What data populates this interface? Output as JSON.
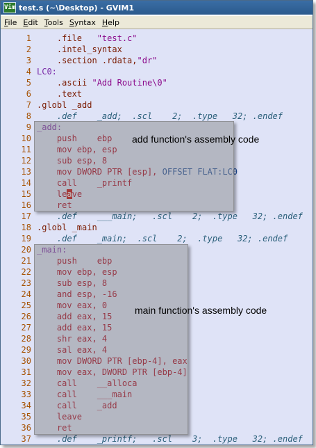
{
  "window": {
    "title": "test.s (~\\Desktop) - GVIM1",
    "icon_label": "Vim"
  },
  "menu": [
    "File",
    "Edit",
    "Tools",
    "Syntax",
    "Help"
  ],
  "callouts": {
    "add": "add function's assembly code",
    "main": "main function's assembly code"
  },
  "lines": [
    {
      "n": "1",
      "parts": [
        [
          "    .file   ",
          "dir"
        ],
        [
          "\"test.c\"",
          "str"
        ]
      ]
    },
    {
      "n": "2",
      "parts": [
        [
          "    .intel_syntax",
          "dir"
        ]
      ]
    },
    {
      "n": "3",
      "parts": [
        [
          "    .section .rdata,",
          "dir"
        ],
        [
          "\"dr\"",
          "str"
        ]
      ]
    },
    {
      "n": "4",
      "parts": [
        [
          "LC0:",
          "lbl"
        ]
      ]
    },
    {
      "n": "5",
      "parts": [
        [
          "    .ascii ",
          "dir"
        ],
        [
          "\"Add Routine\\0\"",
          "str"
        ]
      ]
    },
    {
      "n": "6",
      "parts": [
        [
          "    .text",
          "dir"
        ]
      ]
    },
    {
      "n": "7",
      "parts": [
        [
          ".globl _add",
          "dir"
        ]
      ]
    },
    {
      "n": "8",
      "parts": [
        [
          "    .def    _add;  .scl    2;  .type   32; .endef",
          "type"
        ]
      ]
    },
    {
      "n": "9",
      "parts": [
        [
          "_add:",
          "lbl"
        ]
      ]
    },
    {
      "n": "10",
      "parts": [
        [
          "    push    ebp",
          "kw"
        ]
      ]
    },
    {
      "n": "11",
      "parts": [
        [
          "    mov ebp, esp",
          "kw"
        ]
      ]
    },
    {
      "n": "12",
      "parts": [
        [
          "    sub esp, 8",
          "kw"
        ]
      ]
    },
    {
      "n": "13",
      "parts": [
        [
          "    mov DWORD PTR [esp], ",
          "kw"
        ],
        [
          "OFFSET FLAT:LC0",
          "blue"
        ]
      ]
    },
    {
      "n": "14",
      "parts": [
        [
          "    call    _printf",
          "kw"
        ]
      ]
    },
    {
      "n": "15",
      "parts": [
        [
          "    le",
          "kw"
        ],
        [
          "a",
          "cursor"
        ],
        [
          "ve",
          "kw"
        ]
      ]
    },
    {
      "n": "16",
      "parts": [
        [
          "    ret",
          "kw"
        ]
      ]
    },
    {
      "n": "17",
      "parts": [
        [
          "    .def    ___main;   .scl    2;  .type   32; .endef",
          "type"
        ]
      ]
    },
    {
      "n": "18",
      "parts": [
        [
          ".globl _main",
          "dir"
        ]
      ]
    },
    {
      "n": "19",
      "parts": [
        [
          "    .def    _main;  .scl    2;  .type   32; .endef",
          "type"
        ]
      ]
    },
    {
      "n": "20",
      "parts": [
        [
          "_main:",
          "lbl"
        ]
      ]
    },
    {
      "n": "21",
      "parts": [
        [
          "    push    ebp",
          "kw"
        ]
      ]
    },
    {
      "n": "22",
      "parts": [
        [
          "    mov ebp, esp",
          "kw"
        ]
      ]
    },
    {
      "n": "23",
      "parts": [
        [
          "    sub esp, 8",
          "kw"
        ]
      ]
    },
    {
      "n": "24",
      "parts": [
        [
          "    and esp, -16",
          "kw"
        ]
      ]
    },
    {
      "n": "25",
      "parts": [
        [
          "    mov eax, 0",
          "kw"
        ]
      ]
    },
    {
      "n": "26",
      "parts": [
        [
          "    add eax, 15",
          "kw"
        ]
      ]
    },
    {
      "n": "27",
      "parts": [
        [
          "    add eax, 15",
          "kw"
        ]
      ]
    },
    {
      "n": "28",
      "parts": [
        [
          "    shr eax, 4",
          "kw"
        ]
      ]
    },
    {
      "n": "29",
      "parts": [
        [
          "    sal eax, 4",
          "kw"
        ]
      ]
    },
    {
      "n": "30",
      "parts": [
        [
          "    mov DWORD PTR [ebp-4], eax",
          "kw"
        ]
      ]
    },
    {
      "n": "31",
      "parts": [
        [
          "    mov eax, DWORD PTR [ebp-4]",
          "kw"
        ]
      ]
    },
    {
      "n": "32",
      "parts": [
        [
          "    call    __alloca",
          "kw"
        ]
      ]
    },
    {
      "n": "33",
      "parts": [
        [
          "    call    ___main",
          "kw"
        ]
      ]
    },
    {
      "n": "34",
      "parts": [
        [
          "    call    _add",
          "kw"
        ]
      ]
    },
    {
      "n": "35",
      "parts": [
        [
          "    leave",
          "kw"
        ]
      ]
    },
    {
      "n": "36",
      "parts": [
        [
          "    ret",
          "kw"
        ]
      ]
    },
    {
      "n": "37",
      "parts": [
        [
          "    .def    _printf;   .scl    3;  .type   32; .endef",
          "type"
        ]
      ]
    }
  ]
}
